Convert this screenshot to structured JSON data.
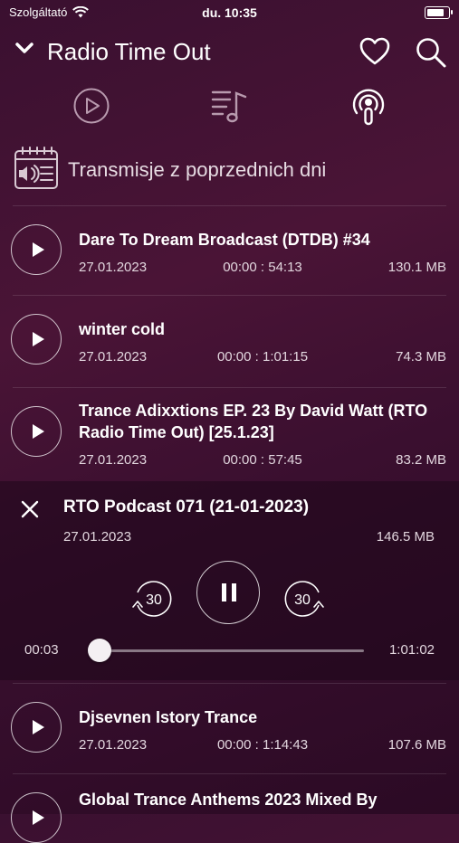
{
  "status": {
    "carrier": "Szolgáltató",
    "time": "du. 10:35"
  },
  "header": {
    "title": "Radio Time Out"
  },
  "section": {
    "label": "Transmisje z poprzednich dni"
  },
  "items": [
    {
      "title": "Dare To Dream Broadcast (DTDB) #34",
      "date": "27.01.2023",
      "duration": "00:00 : 54:13",
      "size": "130.1 MB"
    },
    {
      "title": "winter cold",
      "date": "27.01.2023",
      "duration": "00:00 : 1:01:15",
      "size": "74.3 MB"
    },
    {
      "title": "Trance Adixxtions EP. 23 By David Watt (RTO Radio Time Out) [25.1.23]",
      "date": "27.01.2023",
      "duration": "00:00 : 57:45",
      "size": "83.2 MB"
    },
    {
      "title": "Djsevnen Istory Trance",
      "date": "27.01.2023",
      "duration": "00:00 : 1:14:43",
      "size": "107.6 MB"
    },
    {
      "title": "Global Trance Anthems 2023 Mixed By",
      "date": "",
      "duration": "",
      "size": ""
    }
  ],
  "player": {
    "title": "RTO Podcast 071 (21-01-2023)",
    "date": "27.01.2023",
    "size": "146.5 MB",
    "skip_back": "30",
    "skip_forward": "30",
    "elapsed": "00:03",
    "total": "1:01:02",
    "progress": 0.001
  },
  "icons": {
    "back": "chevron-down-icon",
    "favorite": "heart-icon",
    "search": "search-icon",
    "live": "play-circle-icon",
    "playlist": "music-list-icon",
    "podcast": "podcast-icon",
    "calendar": "calendar-audio-icon"
  }
}
